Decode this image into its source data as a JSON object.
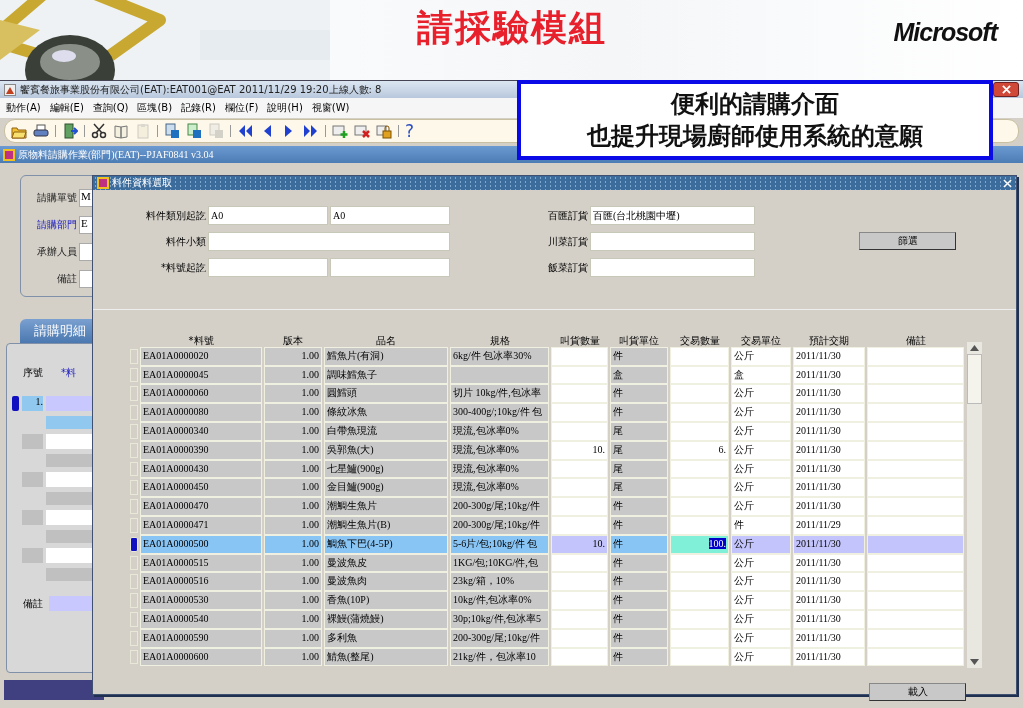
{
  "slide": {
    "title": "請採驗模組",
    "brand": "Microsoft",
    "callout": [
      "便利的請購介面",
      "也提升現場廚師使用系統的意願"
    ]
  },
  "window": {
    "title": "饗賓餐旅事業股份有限公司(EAT):EAT001@EAT 2011/11/29 19:20上線人數: 8",
    "menu": [
      "動作(A)",
      "編輯(E)",
      "查詢(Q)",
      "區塊(B)",
      "記錄(R)",
      "欄位(F)",
      "說明(H)",
      "視窗(W)"
    ],
    "toolbar": [
      [
        {
          "kind": "save",
          "disabled": false
        },
        {
          "kind": "print",
          "disabled": false
        }
      ],
      [
        {
          "kind": "exit",
          "disabled": false
        }
      ],
      [
        {
          "kind": "cut",
          "disabled": false
        },
        {
          "kind": "copy",
          "disabled": false
        },
        {
          "kind": "paste",
          "disabled": true
        }
      ],
      [
        {
          "kind": "query",
          "disabled": false
        },
        {
          "kind": "run",
          "disabled": false
        },
        {
          "kind": "cancel",
          "disabled": true
        }
      ],
      [
        {
          "kind": "first",
          "disabled": false
        },
        {
          "kind": "prev",
          "disabled": false
        },
        {
          "kind": "next",
          "disabled": false
        },
        {
          "kind": "last",
          "disabled": false
        }
      ],
      [
        {
          "kind": "insert",
          "disabled": false
        },
        {
          "kind": "delete",
          "disabled": false
        },
        {
          "kind": "lock",
          "disabled": false
        }
      ],
      [
        {
          "kind": "help",
          "label": "?",
          "disabled": false
        }
      ]
    ]
  },
  "form": {
    "title": "原物料請購作業(部門)(EAT)--PJAF0841 v3.04",
    "fields": [
      {
        "label": "請購單號",
        "value": "M",
        "highlight": false
      },
      {
        "label": "請購部門",
        "value": "E",
        "highlight": true
      },
      {
        "label": "承辦人員",
        "highlight": false
      },
      {
        "label": "備註",
        "highlight": false
      }
    ],
    "tab": "請購明細",
    "columns": [
      {
        "label": "序號",
        "highlight": false
      },
      {
        "label": "*料",
        "highlight": true
      }
    ],
    "rows": [
      {
        "number": "1.",
        "selected": true
      },
      {
        "selected": false
      },
      {
        "selected": false
      },
      {
        "selected": false
      },
      {
        "selected": false
      }
    ],
    "note_label": "備註"
  },
  "dialog": {
    "title": "料件資料選取",
    "filters": [
      {
        "label": "料件類別起訖",
        "range": true,
        "from": "A0",
        "to": "A0"
      },
      {
        "label": "料件小類",
        "range": false
      },
      {
        "label": "*料號起訖",
        "range": true
      }
    ],
    "orders": [
      {
        "label": "百匯訂貨",
        "value": "百匯(台北桃園中壢)"
      },
      {
        "label": "川菜訂貨"
      },
      {
        "label": "飯菜訂貨"
      }
    ],
    "filter_button": "篩選",
    "load_button": "載入",
    "columns": [
      "*料號",
      "版本",
      "品名",
      "規格",
      "叫貨數量",
      "叫貨單位",
      "交易數量",
      "交易單位",
      "預計交期",
      "備註"
    ],
    "rows": [
      {
        "code": "EA01A0000020",
        "version": "1.00",
        "name": "鱈魚片(有洞)",
        "spec": "6kg/件 包冰率30%",
        "unit": "件",
        "trade_unit": "公斤",
        "date": "2011/11/30",
        "selected": false
      },
      {
        "code": "EA01A0000045",
        "version": "1.00",
        "name": "調味鱈魚子",
        "unit": "盒",
        "trade_unit": "盒",
        "date": "2011/11/30",
        "selected": false
      },
      {
        "code": "EA01A0000060",
        "version": "1.00",
        "name": "圓鱈頭",
        "spec": "切片 10kg/件,包冰率",
        "unit": "件",
        "trade_unit": "公斤",
        "date": "2011/11/30",
        "selected": false
      },
      {
        "code": "EA01A0000080",
        "version": "1.00",
        "name": "條紋冰魚",
        "spec": "300-400g/;10kg/件 包",
        "unit": "件",
        "trade_unit": "公斤",
        "date": "2011/11/30",
        "selected": false
      },
      {
        "code": "EA01A0000340",
        "version": "1.00",
        "name": "白帶魚現流",
        "spec": "現流,包冰率0%",
        "unit": "尾",
        "trade_unit": "公斤",
        "date": "2011/11/30",
        "selected": false
      },
      {
        "code": "EA01A0000390",
        "version": "1.00",
        "name": "吳郭魚(大)",
        "spec": "現流,包冰率0%",
        "qty": "10.",
        "unit": "尾",
        "trade_qty": "6.",
        "trade_unit": "公斤",
        "date": "2011/11/30",
        "selected": false
      },
      {
        "code": "EA01A0000430",
        "version": "1.00",
        "name": "七星鱸(900g)",
        "spec": "現流,包冰率0%",
        "unit": "尾",
        "trade_unit": "公斤",
        "date": "2011/11/30",
        "selected": false
      },
      {
        "code": "EA01A0000450",
        "version": "1.00",
        "name": "金目鱸(900g)",
        "spec": "現流,包冰率0%",
        "unit": "尾",
        "trade_unit": "公斤",
        "date": "2011/11/30",
        "selected": false
      },
      {
        "code": "EA01A0000470",
        "version": "1.00",
        "name": "潮鯛生魚片",
        "spec": "200-300g/尾;10kg/件",
        "unit": "件",
        "trade_unit": "公斤",
        "date": "2011/11/30",
        "selected": false
      },
      {
        "code": "EA01A0000471",
        "version": "1.00",
        "name": "潮鯛生魚片(B)",
        "spec": "200-300g/尾;10kg/件",
        "unit": "件",
        "trade_unit": "件",
        "date": "2011/11/29",
        "selected": false
      },
      {
        "code": "EA01A0000500",
        "version": "1.00",
        "name": "鯛魚下巴(4-5P)",
        "spec": "5-6片/包;10kg/件 包",
        "qty": "10.",
        "unit": "件",
        "trade_qty": "100.",
        "trade_unit": "公斤",
        "date": "2011/11/30",
        "selected": true
      },
      {
        "code": "EA01A0000515",
        "version": "1.00",
        "name": "曼波魚皮",
        "spec": "1KG/包;10KG/件,包",
        "unit": "件",
        "trade_unit": "公斤",
        "date": "2011/11/30",
        "selected": false
      },
      {
        "code": "EA01A0000516",
        "version": "1.00",
        "name": "曼波魚肉",
        "spec": "23kg/箱，10%",
        "unit": "件",
        "trade_unit": "公斤",
        "date": "2011/11/30",
        "selected": false
      },
      {
        "code": "EA01A0000530",
        "version": "1.00",
        "name": "香魚(10P)",
        "spec": "10kg/件,包冰率0%",
        "unit": "件",
        "trade_unit": "公斤",
        "date": "2011/11/30",
        "selected": false
      },
      {
        "code": "EA01A0000540",
        "version": "1.00",
        "name": "裸鰻(蒲燒鰻)",
        "spec": "30p;10kg/件,包冰率5",
        "unit": "件",
        "trade_unit": "公斤",
        "date": "2011/11/30",
        "selected": false
      },
      {
        "code": "EA01A0000590",
        "version": "1.00",
        "name": "多利魚",
        "spec": "200-300g/尾;10kg/件",
        "unit": "件",
        "trade_unit": "公斤",
        "date": "2011/11/30",
        "selected": false
      },
      {
        "code": "EA01A0000600",
        "version": "1.00",
        "name": "鯖魚(整尾)",
        "spec": "21kg/件，包冰率10",
        "unit": "件",
        "trade_unit": "公斤",
        "date": "2011/11/30",
        "selected": false
      }
    ]
  }
}
